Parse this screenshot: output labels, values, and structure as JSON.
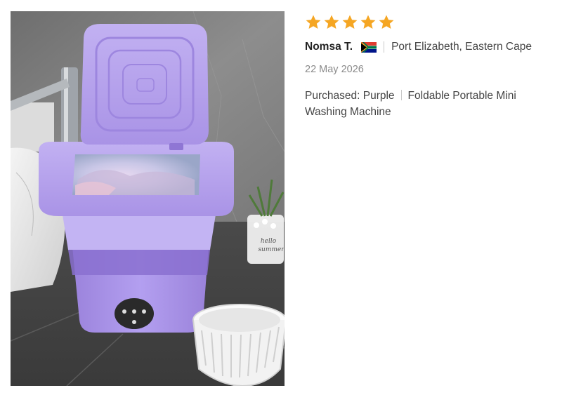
{
  "review": {
    "rating": 5,
    "rating_max": 5,
    "star_color": "#f5a623",
    "reviewer_name": "Nomsa T.",
    "country_flag": "south-africa-flag",
    "location": "Port Elizabeth, Eastern Cape",
    "date": "22 May 2026",
    "purchased_label": "Purchased:",
    "variant": "Purple",
    "product_name": "Foldable Portable Mini Washing Machine"
  },
  "photo": {
    "subject": "purple foldable washing machine",
    "panel_text": [
      "hello",
      "summer"
    ],
    "colors": {
      "machine": "#a58ee0",
      "lid": "#b6a2ec",
      "background": "#8a8a8a"
    }
  }
}
